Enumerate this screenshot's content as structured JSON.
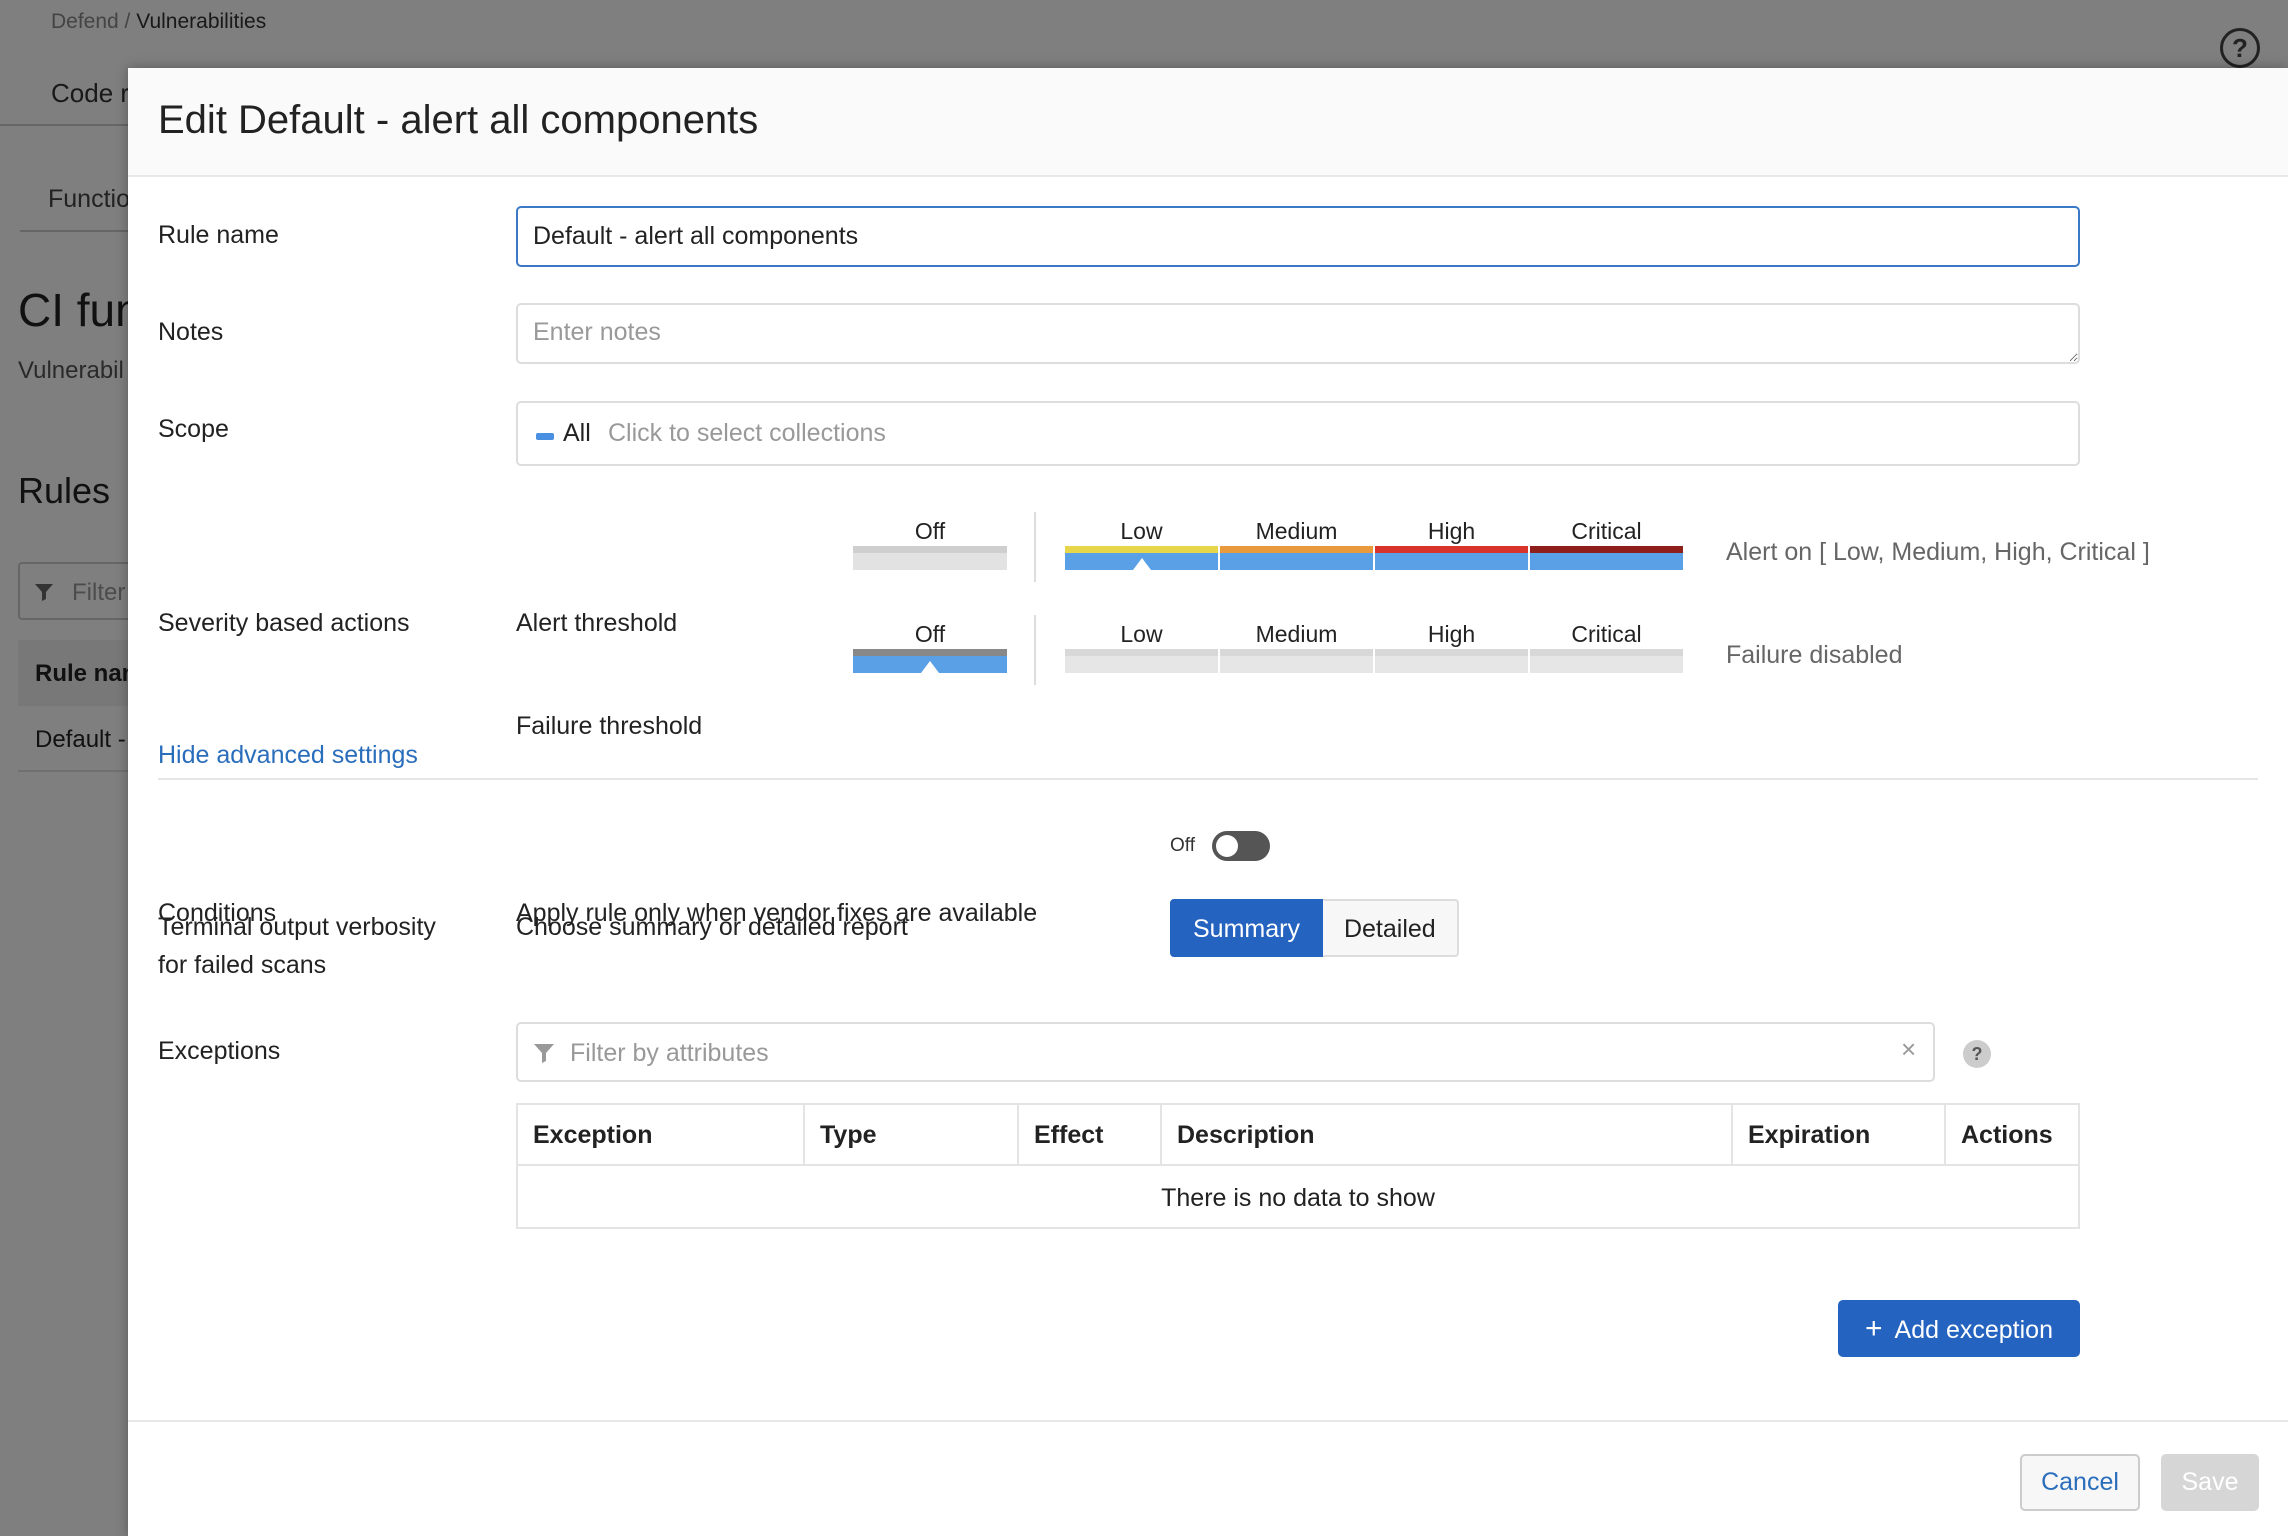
{
  "background": {
    "breadcrumb_parent": "Defend",
    "breadcrumb_sep": " / ",
    "breadcrumb_current": "Vulnerabilities",
    "tab_top": "Code r",
    "tab_sub": "Functio",
    "page_title": "CI fun",
    "page_subtitle": "Vulnerabil",
    "rules_heading": "Rules",
    "filter_placeholder": "Filter",
    "table_header": "Rule nam",
    "table_row": "Default -"
  },
  "modal": {
    "title": "Edit Default - alert all components",
    "rule_name": {
      "label": "Rule name",
      "value": "Default - alert all components"
    },
    "notes": {
      "label": "Notes",
      "placeholder": "Enter notes"
    },
    "scope": {
      "label": "Scope",
      "chip": "All",
      "placeholder": "Click to select collections",
      "chip_color": "#4a90e2"
    },
    "severity": {
      "label": "Severity based actions",
      "alert": {
        "label": "Alert threshold",
        "off_label": "Off",
        "levels": [
          "Low",
          "Medium",
          "High",
          "Critical"
        ],
        "status": "Alert on [ Low, Medium, High, Critical ]",
        "selected": "Low"
      },
      "failure": {
        "label": "Failure threshold",
        "off_label": "Off",
        "levels": [
          "Low",
          "Medium",
          "High",
          "Critical"
        ],
        "status": "Failure disabled",
        "selected": "Off"
      },
      "colors": {
        "low": "#e8d64a",
        "medium": "#e89a3c",
        "high": "#d9342b",
        "critical": "#8e1f1a",
        "selected": "#5aa0e6",
        "off": "#cfcfcf"
      }
    },
    "advanced_link": "Hide advanced settings",
    "conditions": {
      "label": "Conditions",
      "description": "Apply rule only when vendor fixes are available",
      "toggle_label": "Off"
    },
    "verbosity": {
      "label_line1": "Terminal output verbosity",
      "label_line2": "for failed scans",
      "description": "Choose summary or detailed report",
      "options": [
        "Summary",
        "Detailed"
      ],
      "selected": "Summary"
    },
    "exceptions": {
      "label": "Exceptions",
      "filter_placeholder": "Filter by attributes",
      "help": "?",
      "columns": [
        "Exception",
        "Type",
        "Effect",
        "Description",
        "Expiration",
        "Actions"
      ],
      "empty_text": "There is no data to show",
      "add_button": "Add exception",
      "add_icon": "+"
    },
    "footer": {
      "cancel": "Cancel",
      "save": "Save"
    }
  }
}
